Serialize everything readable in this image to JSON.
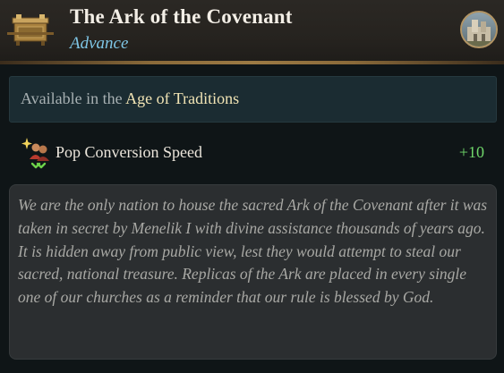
{
  "header": {
    "title": "The Ark of the Covenant",
    "subtitle": "Advance",
    "icon": "ark-icon",
    "portrait": "cathedral-portrait"
  },
  "availability": {
    "prefix": "Available in the ",
    "age": "Age of Traditions"
  },
  "modifiers": [
    {
      "icon": "pop-conversion-icon",
      "label": "Pop Conversion Speed",
      "value": "+10"
    }
  ],
  "lore": {
    "text": "We are the only nation to house the sacred Ark of the Covenant after it was taken in secret by Menelik I with divine assistance thousands of years ago. It is hidden away from public view, lest they would attempt to steal our sacred, national treasure. Replicas of the Ark are placed in every single one of our churches as a reminder that our rule is blessed by God."
  },
  "colors": {
    "title": "#f3eee6",
    "subtitle": "#7fc6e6",
    "age_highlight": "#f1e4b4",
    "positive_value": "#6fd66a",
    "gold_border": "#9c7a44"
  }
}
